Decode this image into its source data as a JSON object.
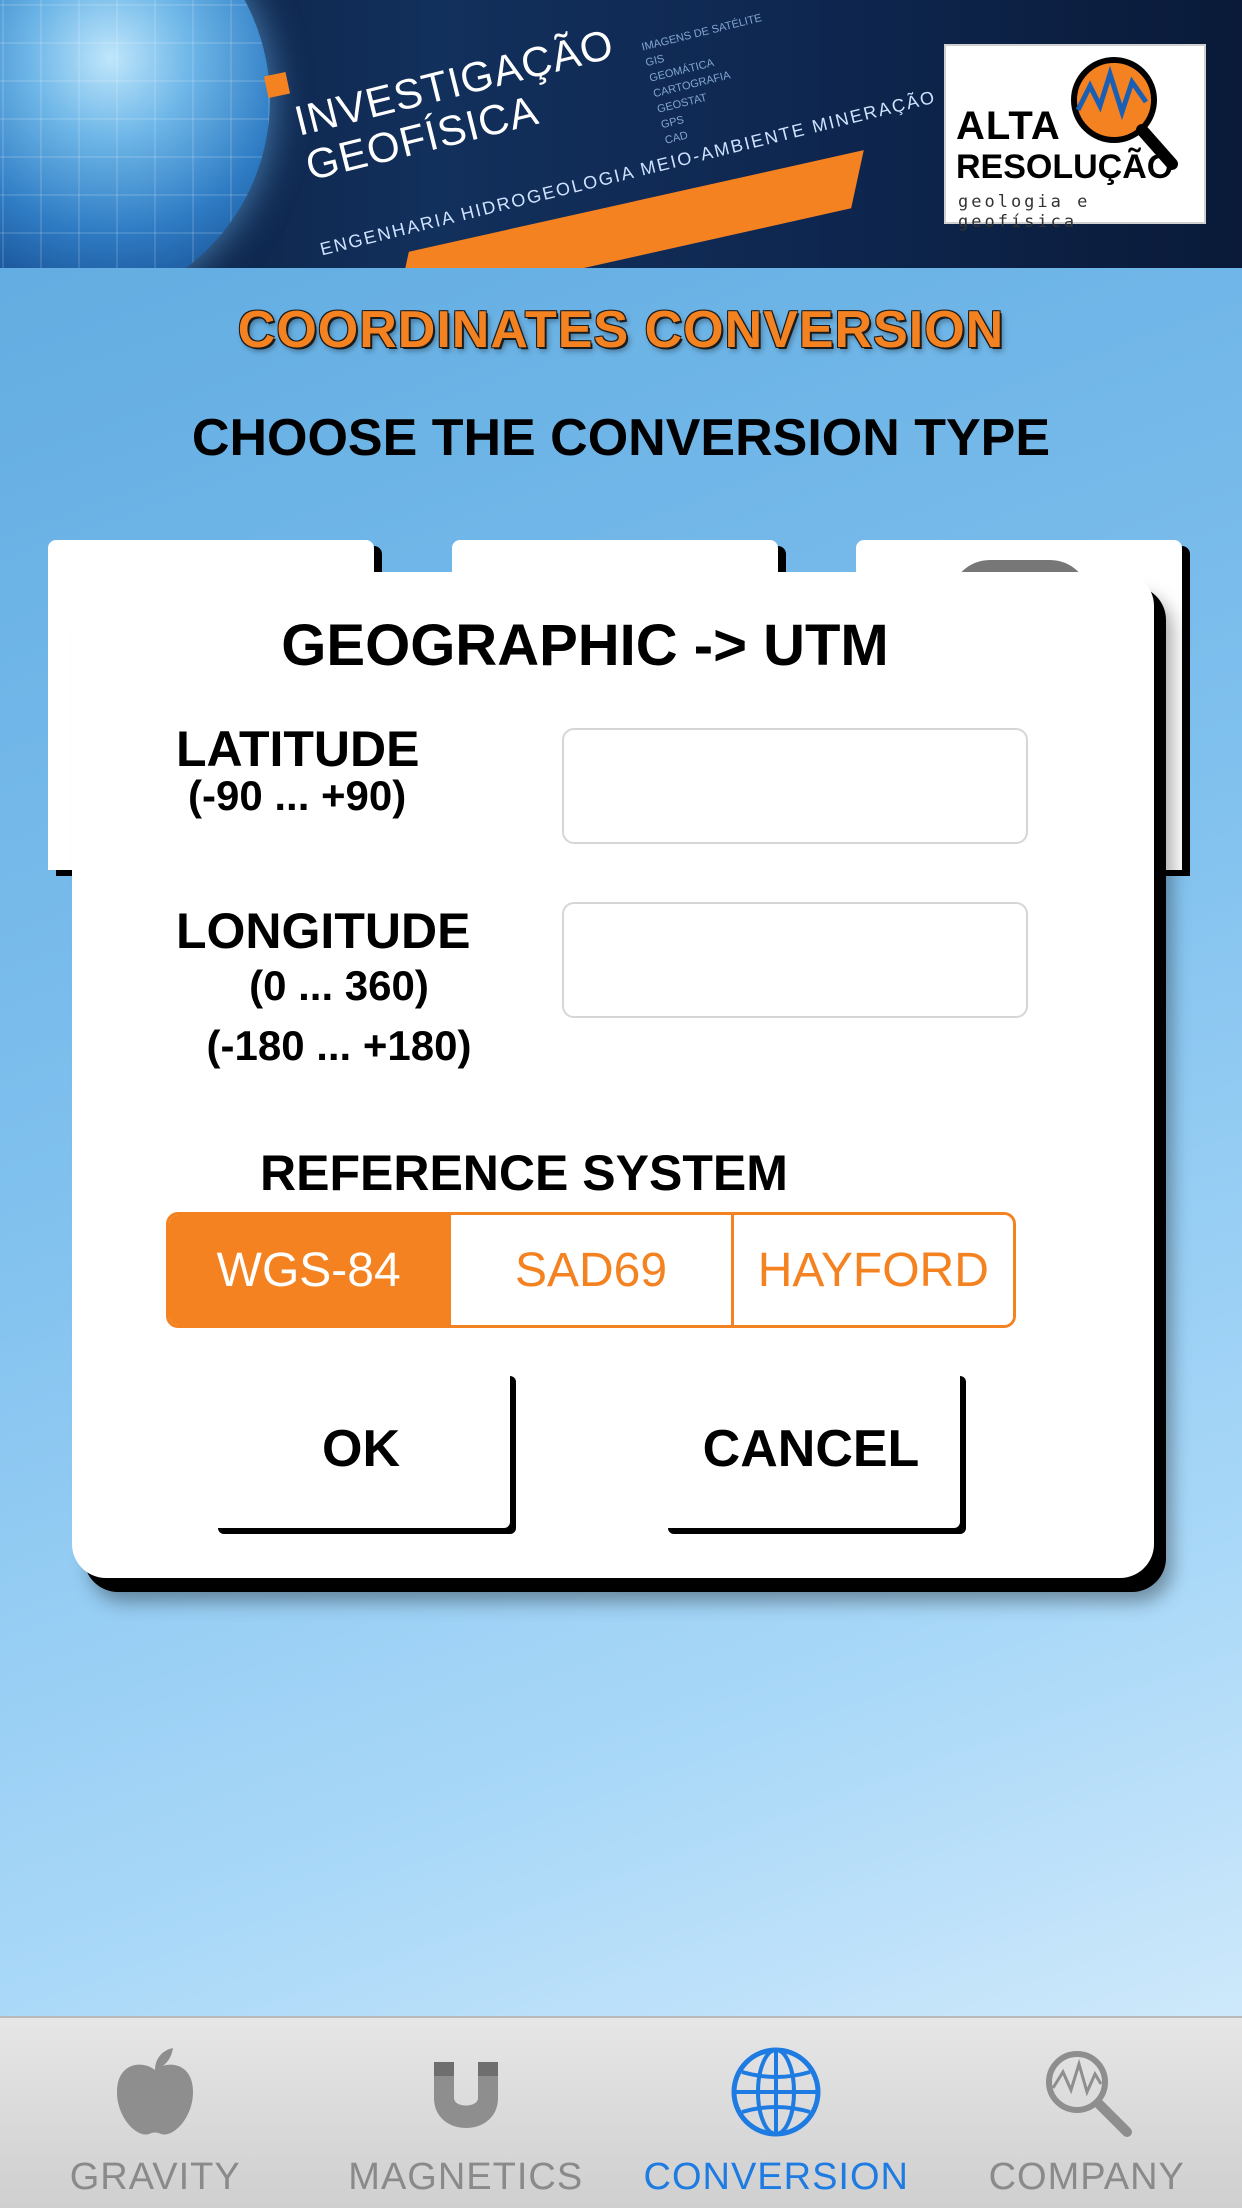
{
  "banner": {
    "title_line1": "INVESTIGAÇÃO",
    "title_line2": "GEOFÍSICA",
    "tagline": "ENGENHARIA   HIDROGEOLOGIA   MEIO-AMBIENTE   MINERAÇÃO",
    "small_text": "IMAGENS DE SATÉLITE\nGIS\nGEOMÁTICA\nCARTOGRAFIA\nGEOSTAT\nGPS\nCAD",
    "logo_line1": "ALTA",
    "logo_line2": "RESOLUÇÃO",
    "logo_sub": "geologia e geofísica"
  },
  "header": {
    "title": "COORDINATES CONVERSION",
    "subtitle": "CHOOSE THE CONVERSION TYPE"
  },
  "dialog": {
    "title": "GEOGRAPHIC -> UTM",
    "latitude_label": "LATITUDE",
    "latitude_range": "(-90 ... +90)",
    "latitude_value": "",
    "longitude_label": "LONGITUDE",
    "longitude_range1": "(0 ... 360)",
    "longitude_range2": "(-180 ... +180)",
    "longitude_value": "",
    "reference_label": "REFERENCE SYSTEM",
    "reference_options": [
      "WGS-84",
      "SAD69",
      "HAYFORD"
    ],
    "reference_selected": "WGS-84",
    "ok_label": "OK",
    "cancel_label": "CANCEL"
  },
  "tabbar": {
    "items": [
      {
        "label": "GRAVITY",
        "icon": "apple-icon"
      },
      {
        "label": "MAGNETICS",
        "icon": "magnet-icon"
      },
      {
        "label": "CONVERSION",
        "icon": "globe-icon"
      },
      {
        "label": "COMPANY",
        "icon": "magnifier-icon"
      }
    ],
    "active": "CONVERSION"
  },
  "colors": {
    "accent": "#f58220",
    "active_tab": "#1e7be2",
    "inactive_tab": "#8a8a8a"
  }
}
